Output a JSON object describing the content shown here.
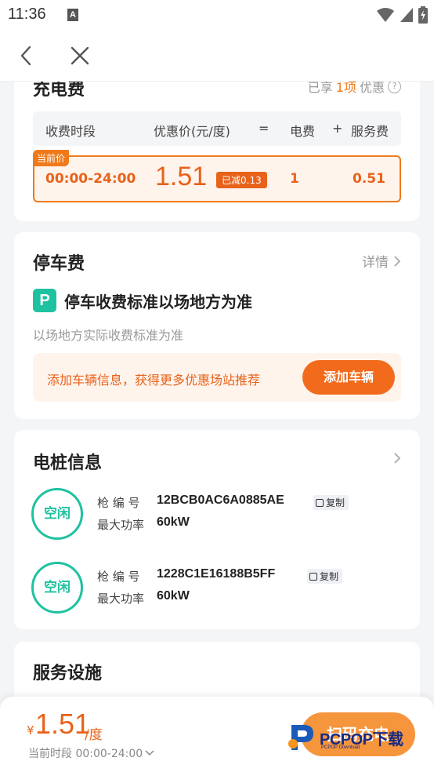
{
  "status_bar": {
    "time": "11:36",
    "app_icon": "A"
  },
  "nav": {
    "back_icon": "chevron-left-icon",
    "close_icon": "close-icon"
  },
  "charge_card": {
    "title": "充电费",
    "discount_prefix": "已享",
    "discount_count": "1项",
    "discount_suffix": "优惠",
    "header": {
      "period": "收费时段",
      "price": "优惠价(元/度)",
      "eq": "=",
      "electricity": "电费",
      "plus": "+",
      "service": "服务费"
    },
    "row": {
      "tag": "当前价",
      "period": "00:00-24:00",
      "price": "1.51",
      "reduced": "已减0.13",
      "electricity": "1",
      "service": "0.51"
    }
  },
  "parking_card": {
    "title": "停车费",
    "detail": "详情",
    "logo": "P",
    "standard": "停车收费标准以场地方为准",
    "sub": "以场地方实际收费标准为准",
    "promo": "添加车辆信息，获得更多优惠场站推荐",
    "add_button": "添加车辆"
  },
  "pile_card": {
    "title": "电桩信息",
    "piles": [
      {
        "status": "空闲",
        "code_label": "枪 编 号",
        "code": "12BCB0AC6A0885AE",
        "copy": "复制",
        "power_label": "最大功率",
        "power": "60kW"
      },
      {
        "status": "空闲",
        "code_label": "枪 编 号",
        "code": "1228C1E16188B5FF",
        "copy": "复制",
        "power_label": "最大功率",
        "power": "60kW"
      }
    ]
  },
  "service_card": {
    "title": "服务设施"
  },
  "bottom_bar": {
    "currency": "¥",
    "price": "1.51",
    "unit": "/度",
    "slot_label": "当前时段 00:00-24:00",
    "scan_button": "扫码充电"
  },
  "watermark": {
    "text": "PCPOP下载",
    "sub": "PCPOP Download"
  },
  "colors": {
    "accent": "#f07a1a",
    "green": "#1fc2a0"
  }
}
